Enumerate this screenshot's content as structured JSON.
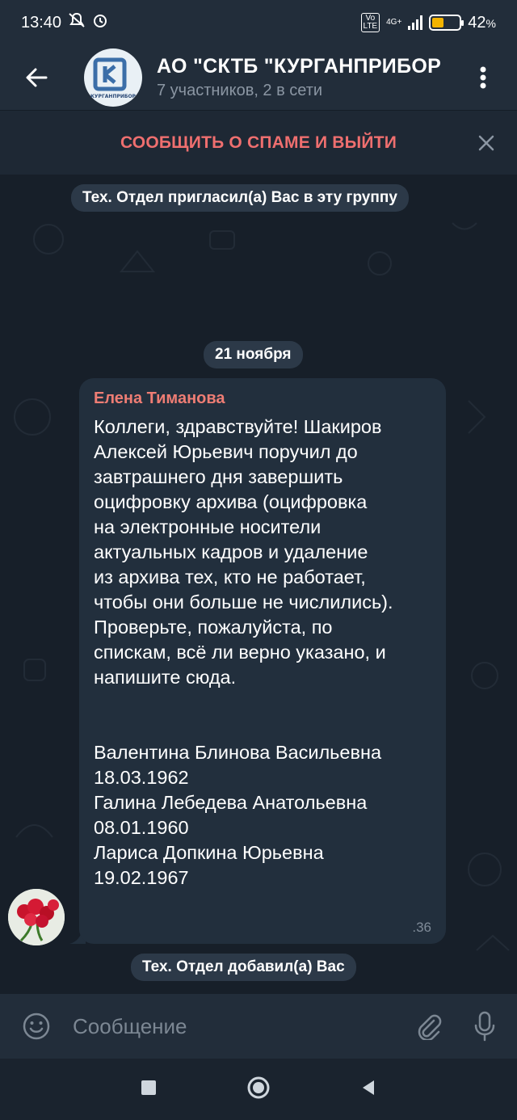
{
  "status": {
    "time": "13:40",
    "network": "4G+",
    "lte_top": "Vo",
    "lte_bottom": "LTE",
    "battery_percent": "42",
    "battery_level": 0.42
  },
  "header": {
    "title": "АО \"СКТБ \"КУРГАНПРИБОР",
    "subtitle": "7 участников, 2 в сети",
    "avatar_caption": "КУРГАНПРИБОР"
  },
  "spam_bar": {
    "label": "СООБЩИТЬ О СПАМЕ И ВЫЙТИ"
  },
  "chat": {
    "service_invite": "Тех. Отдел пригласил(а) Вас в эту группу",
    "date": "21 ноября",
    "message": {
      "sender": "Елена Тиманова",
      "text": "Коллеги, здравствуйте! Шакиров\nАлексей Юрьевич поручил до\nзавтрашнего дня завершить\nоцифровку архива (оцифровка\nна электронные носители\nактуальных кадров и удаление\nиз архива тех, кто не работает,\nчтобы они больше не числились).\nПроверьте, пожалуйста, по\nспискам, всё ли верно указано, и\nнапишите сюда.\n\n\nВалентина Блинова Васильевна\n18.03.1962\nГалина Лебедева Анатольевна\n08.01.1960\nЛариса Допкина Юрьевна\n19.02.1967",
      "time": ".36"
    },
    "service_added": "Тех. Отдел добавил(а) Вас"
  },
  "composer": {
    "placeholder": "Сообщение"
  },
  "colors": {
    "background": "#171f29",
    "header": "#222d3a",
    "bubble": "#222f3d",
    "sender": "#ee7d74",
    "spam": "#ef6f6f"
  },
  "icons": {
    "back": "arrow-left-icon",
    "menu": "more-vertical-icon",
    "close": "close-icon",
    "emoji": "emoji-icon",
    "attach": "paperclip-icon",
    "mic": "microphone-icon"
  }
}
